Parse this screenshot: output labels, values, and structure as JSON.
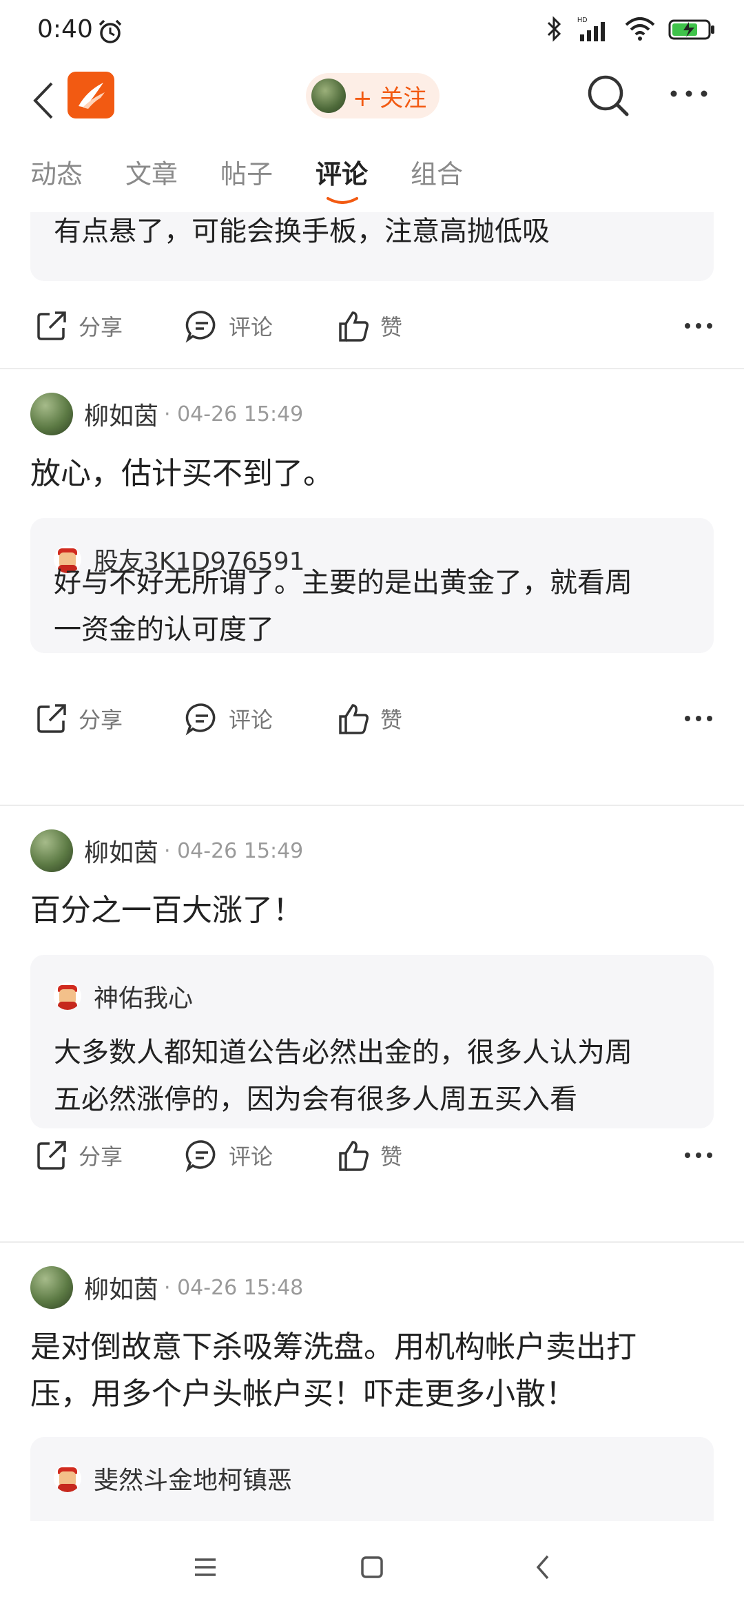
{
  "status": {
    "time": "0:40"
  },
  "header": {
    "follow_label": "+ 关注"
  },
  "tabs": [
    {
      "label": "动态"
    },
    {
      "label": "文章"
    },
    {
      "label": "帖子"
    },
    {
      "label": "评论"
    },
    {
      "label": "组合"
    }
  ],
  "colors": {
    "accent": "#f25a12",
    "quote_bg": "#f6f6f8"
  },
  "actions": {
    "share": "分享",
    "comment": "评论",
    "like": "赞"
  },
  "posts": [
    {
      "quote_text": "有点悬了，可能会换手板，注意高抛低吸"
    },
    {
      "author": "柳如茵",
      "time": "· 04-26 15:49",
      "text": "放心，估计买不到了。",
      "quote_user": "股友3K1D976591",
      "quote_line1": "好与不好无所谓了。主要的是出黄金了，就看周",
      "quote_line2": "一资金的认可度了"
    },
    {
      "author": "柳如茵",
      "time": "· 04-26 15:49",
      "text": "百分之一百大涨了！",
      "quote_user": "神佑我心",
      "quote_line1": "大多数人都知道公告必然出金的，很多人认为周",
      "quote_line2": "五必然涨停的，因为会有很多人周五买入看"
    },
    {
      "author": "柳如茵",
      "time": "· 04-26 15:48",
      "text_line1": "是对倒故意下杀吸筹洗盘。用机构帐户卖出打",
      "text_line2": "压，用多个户头帐户买！吓走更多小散！",
      "quote_user": "斐然斗金地柯镇恶"
    }
  ]
}
